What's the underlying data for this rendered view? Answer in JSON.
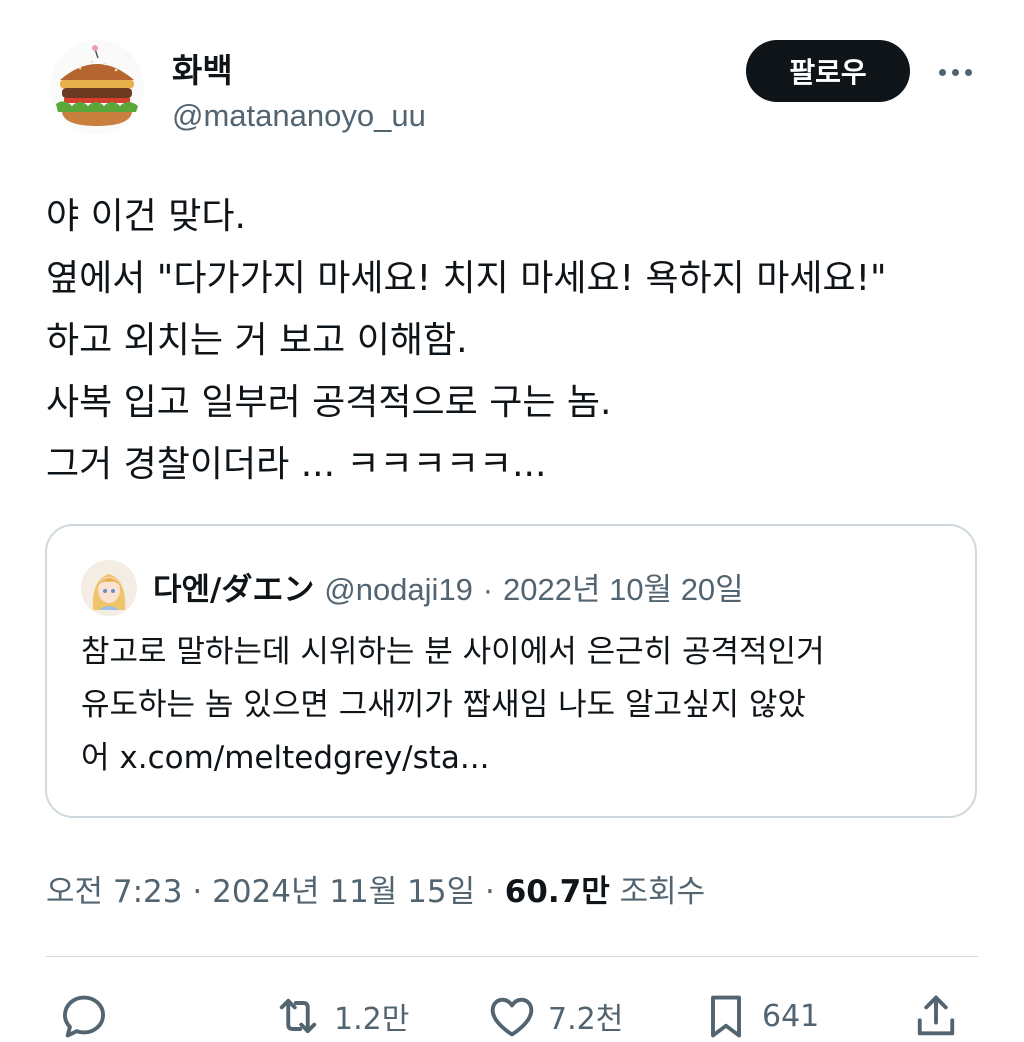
{
  "author": {
    "display_name": "화백",
    "handle": "@matananoyo_uu",
    "avatar_icon": "hamburger-icon"
  },
  "follow_label": "팔로우",
  "more_icon": "more-options-icon",
  "tweet_lines": [
    "야 이건 맞다.",
    "옆에서 \"다가가지 마세요! 치지 마세요! 욕하지 마세요!\"",
    "하고 외치는 거 보고 이해함.",
    "사복 입고 일부러 공격적으로 구는 놈.",
    "그거 경찰이더라 ... ㅋㅋㅋㅋㅋ..."
  ],
  "quote": {
    "display_name": "다엔/ダエン",
    "handle": "@nodaji19",
    "separator": "·",
    "date": "2022년 10월 20일",
    "lines": [
      "참고로 말하는데 시위하는 분 사이에서 은근히 공격적인거",
      "유도하는 놈 있으면 그새끼가 짭새임 나도 알고싶지 않았",
      "어 x.com/meltedgrey/sta..."
    ]
  },
  "meta": {
    "time": "오전 7:23",
    "separator": "·",
    "date": "2024년 11월 15일",
    "separator2": "·",
    "views": "60.7만",
    "views_label": "조회수"
  },
  "actions": {
    "reply_count": "",
    "retweet_count": "1.2만",
    "like_count": "7.2천",
    "bookmark_count": "641"
  },
  "colors": {
    "text": "#0f1419",
    "secondary": "#536471",
    "border": "#cfd9de",
    "button_bg": "#0f1419"
  }
}
